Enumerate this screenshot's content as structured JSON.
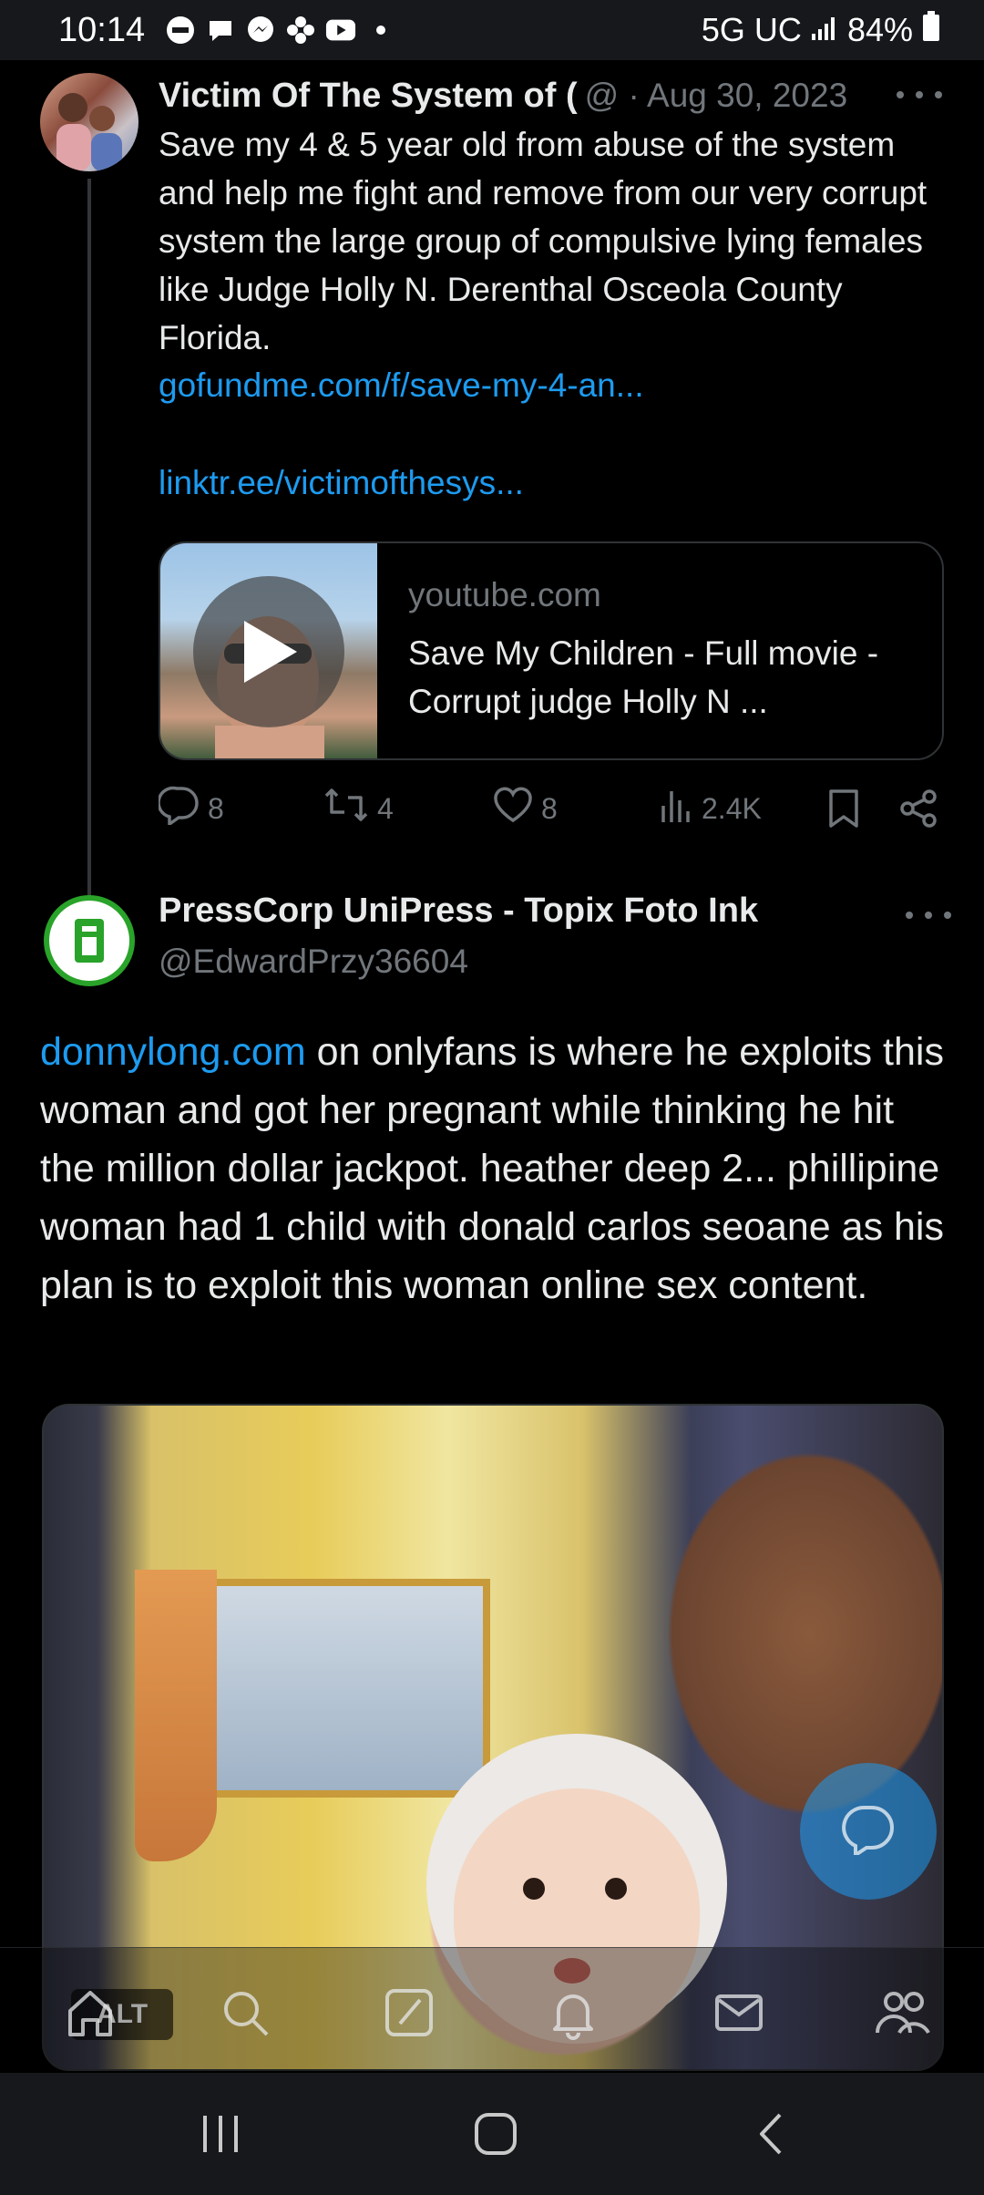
{
  "status_bar": {
    "time": "10:14",
    "network": "5G UC",
    "battery": "84%"
  },
  "tweet1": {
    "author_name": "Victim Of The System of (",
    "meta": "@ · Aug 30, 2023",
    "body": "Save my 4 & 5 year old from abuse of the system and help me fight and remove from our very corrupt system the large group of compulsive lying females like Judge Holly N. Derenthal Osceola County Florida.",
    "link1": "gofundme.com/f/save-my-4-an...",
    "link2": "linktr.ee/victimofthesys...",
    "card": {
      "domain": "youtube.com",
      "title": "Save My Children - Full movie - Corrupt judge Holly N ..."
    },
    "stats": {
      "replies": "8",
      "reposts": "4",
      "likes": "8",
      "views": "2.4K"
    }
  },
  "tweet2": {
    "author_name": "PressCorp UniPress - Topix Foto Ink",
    "handle": "@EdwardPrzy36604",
    "body_link": "donnylong.com",
    "body_text": " on onlyfans is where he exploits this woman and got her pregnant while thinking he hit the million dollar jackpot. heather deep 2... phillipine woman had 1 child with donald carlos seoane as his plan is to exploit this woman online sex content.",
    "media_alt_badge": "ALT"
  },
  "colors": {
    "background": "#000000",
    "text": "#e7e9ea",
    "secondary": "#71767b",
    "link": "#1d9bf0",
    "border": "#2f3336"
  },
  "icons": {
    "status": [
      "do-not-disturb-icon",
      "chat-icon",
      "messenger-icon",
      "pinwheel-icon",
      "youtube-icon",
      "dot-icon"
    ],
    "actions": [
      "reply-icon",
      "repost-icon",
      "like-icon",
      "views-icon",
      "bookmark-icon",
      "share-icon"
    ],
    "bottom_nav": [
      "home-icon",
      "search-icon",
      "grok-icon",
      "notifications-icon",
      "messages-icon",
      "communities-icon"
    ],
    "system_nav": [
      "recents-icon",
      "home-button-icon",
      "back-icon"
    ]
  }
}
